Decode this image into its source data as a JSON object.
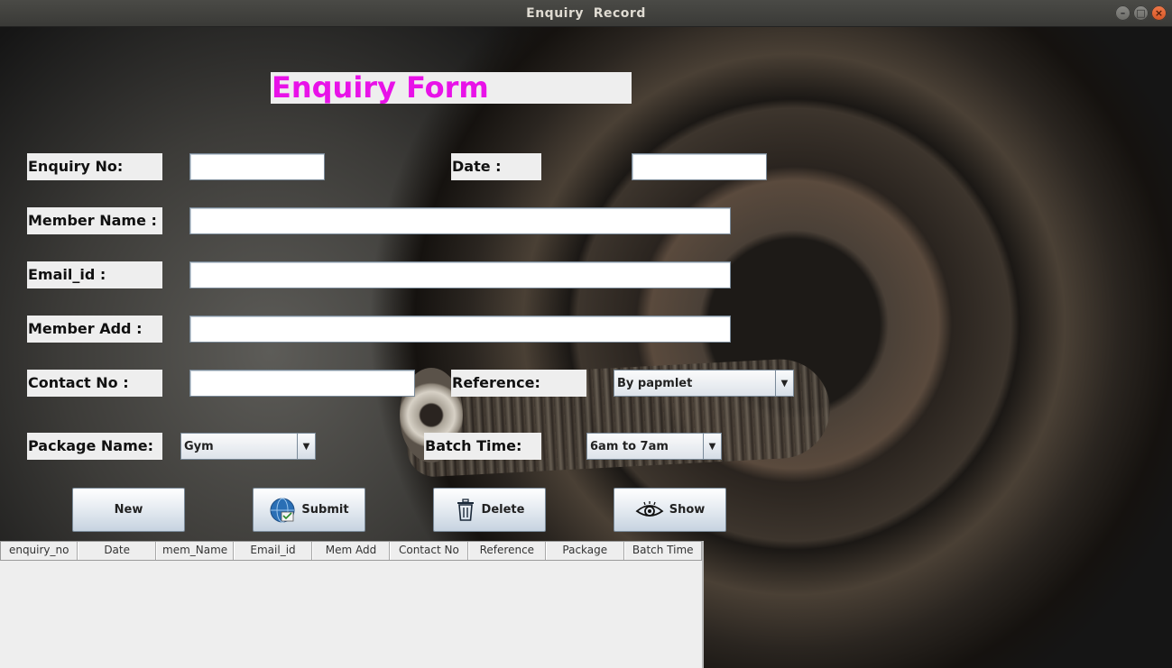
{
  "window": {
    "title": "Enquiry  Record",
    "minimize_glyph": "–",
    "maximize_glyph": "□",
    "close_glyph": "×"
  },
  "form": {
    "heading": "Enquiry Form",
    "enquiry_no_label": "Enquiry No:",
    "enquiry_no_value": "",
    "date_label": "Date :",
    "date_value": "",
    "member_name_label": "Member Name :",
    "member_name_value": "",
    "email_label": "Email_id :",
    "email_value": "",
    "member_add_label": "Member Add :",
    "member_add_value": "",
    "contact_no_label": "Contact No :",
    "contact_no_value": "",
    "reference_label": "Reference:",
    "reference_selected": "By papmlet",
    "package_label": "Package Name:",
    "package_selected": "Gym",
    "batch_time_label": "Batch Time:",
    "batch_time_selected": "6am to 7am"
  },
  "buttons": {
    "new_label": "New",
    "submit_label": "Submit",
    "delete_label": "Delete",
    "show_label": "Show"
  },
  "table": {
    "columns": [
      "enquiry_no",
      "Date",
      "mem_Name",
      "Email_id",
      "Mem Add",
      "Contact No",
      "Reference",
      "Package",
      "Batch Time"
    ],
    "rows": []
  },
  "colors": {
    "heading_text": "#e812e8",
    "label_bg": "#eeeeee",
    "titlebar_bg": "#3f3f3c"
  },
  "icons": {
    "submit": "submit-globe-icon",
    "delete": "trash-icon",
    "show": "eye-icon",
    "combo_arrow": "chevron-down-icon"
  }
}
